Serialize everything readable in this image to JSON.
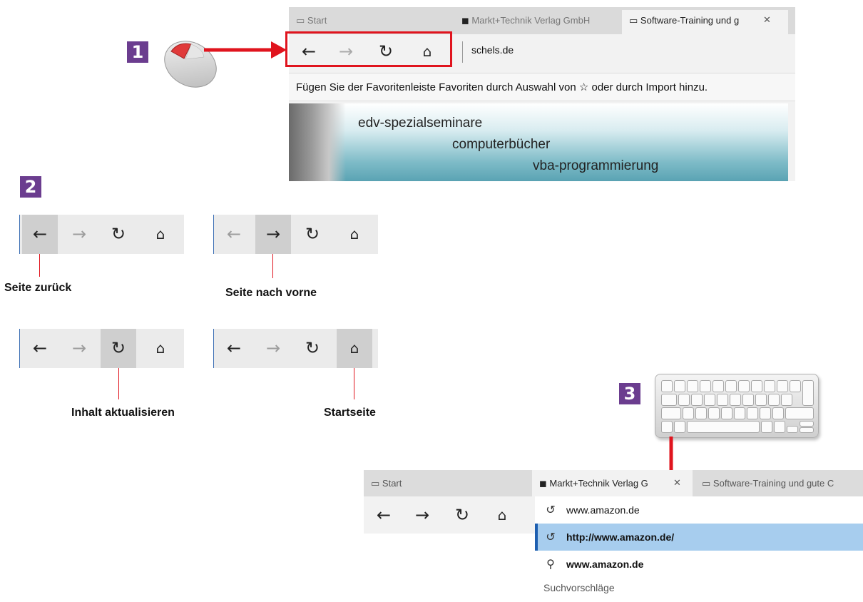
{
  "step1": {
    "badge": "1",
    "browser": {
      "tabs": [
        "Start",
        "Markt+Technik Verlag GmbH",
        "Software-Training und g"
      ],
      "close_glyph": "✕",
      "nav": {
        "back": "←",
        "forward": "→",
        "refresh": "↻",
        "home": "⌂"
      },
      "address": "schels.de",
      "favorites_hint": "Fügen Sie der Favoritenleiste Favoriten durch Auswahl von ☆ oder durch Import hinzu.",
      "banner_lines": [
        "edv-spezialseminare",
        "computerbücher",
        "vba-programmierung"
      ]
    },
    "highlight_color": "#e0141e",
    "device_icon": "mouse-icon"
  },
  "step2": {
    "badge": "2",
    "nav_glyphs": {
      "back": "←",
      "forward": "→",
      "refresh": "↻",
      "home": "⌂"
    },
    "captions": [
      "Seite zurück",
      "Seite nach vorne",
      "Inhalt aktualisieren",
      "Startseite"
    ]
  },
  "step3": {
    "badge": "3",
    "device_icon": "keyboard-icon",
    "browser": {
      "tabs": [
        "Start",
        "Markt+Technik Verlag G",
        "Software-Training und gute C"
      ],
      "close_glyph": "✕",
      "nav": {
        "back": "←",
        "forward": "→",
        "refresh": "↻",
        "home": "⌂"
      },
      "suggestions": [
        {
          "icon": "history-icon",
          "glyph": "↺",
          "text": "www.amazon.de"
        },
        {
          "icon": "history-icon",
          "glyph": "↺",
          "text": "http://www.amazon.de/"
        },
        {
          "icon": "search-icon",
          "glyph": "⚲",
          "text": "www.amazon.de"
        }
      ],
      "suggest_header": "Suchvorschläge"
    }
  },
  "colors": {
    "badge": "#6b3d8f",
    "arrow": "#e0141e",
    "selection": "#a7cdee"
  }
}
